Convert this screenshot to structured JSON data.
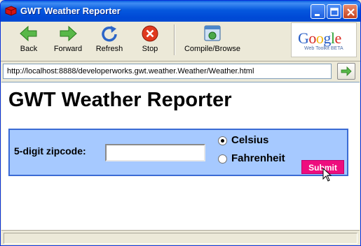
{
  "window": {
    "title": "GWT Weather Reporter"
  },
  "toolbar": {
    "back_label": "Back",
    "forward_label": "Forward",
    "refresh_label": "Refresh",
    "stop_label": "Stop",
    "compile_label": "Compile/Browse",
    "logo": {
      "word": "Google",
      "tagline": "Web Toolkit BETA"
    }
  },
  "address": {
    "url": "http://localhost:8888/developerworks.gwt.weather.Weather/Weather.html"
  },
  "page": {
    "heading": "GWT Weather Reporter",
    "zip_label": "5-digit zipcode:",
    "zip_value": "",
    "units": {
      "options": [
        "Celsius",
        "Fahrenheit"
      ],
      "selected": "Celsius"
    },
    "submit_label": "Submit"
  },
  "colors": {
    "title_bar": "#0558de",
    "panel_bg": "#a6c9ff",
    "panel_border": "#3b6bd4",
    "submit_bg": "#ee0d7e"
  },
  "icons": {
    "back": "green-left-arrow-icon",
    "forward": "green-right-arrow-icon",
    "refresh": "refresh-icon",
    "stop": "stop-icon",
    "compile": "compile-browse-icon",
    "go": "go-arrow-icon"
  }
}
